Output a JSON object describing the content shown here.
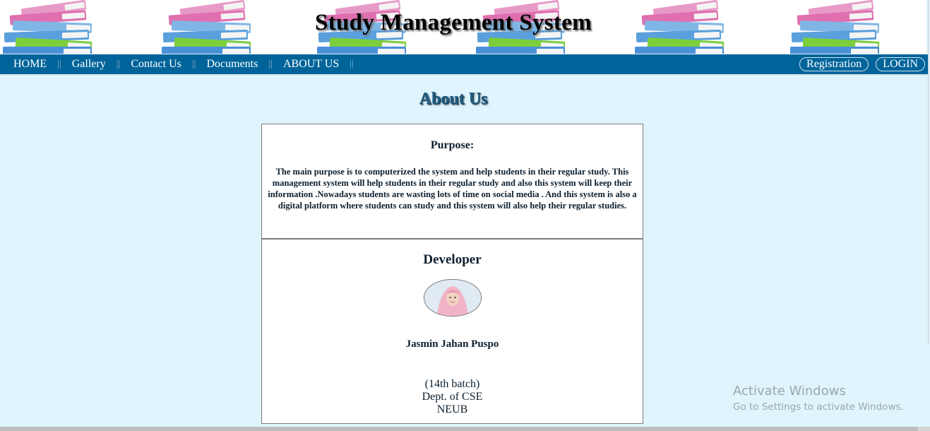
{
  "header": {
    "title": "Study Management System",
    "banner_decoration": "book-stack-icon"
  },
  "nav": {
    "items": [
      {
        "label": "HOME"
      },
      {
        "label": "Gallery"
      },
      {
        "label": "Contact Us"
      },
      {
        "label": "Documents"
      },
      {
        "label": "ABOUT US"
      }
    ],
    "separator": "||",
    "right": {
      "registration": "Registration",
      "login": "LOGIN"
    }
  },
  "page": {
    "heading": "About Us"
  },
  "purpose": {
    "title": "Purpose:",
    "text": "The main purpose is to computerized the system and help students in their regular study. This management system will help students in their regular study and also this system will keep their information .Nowadays students are wasting lots of time on social media . And this system is also a digital platform where students can study and this system will also help their regular studies."
  },
  "developer": {
    "title": "Developer",
    "name": "Jasmin Jahan Puspo",
    "batch": "(14th batch)",
    "dept": "Dept. of CSE",
    "university": "NEUB"
  },
  "watermark": {
    "line1": "Activate Windows",
    "line2": "Go to Settings to activate Windows."
  },
  "colors": {
    "nav_bg": "#00649a",
    "page_bg": "#e0f4fd",
    "heading": "#1f5d82"
  }
}
